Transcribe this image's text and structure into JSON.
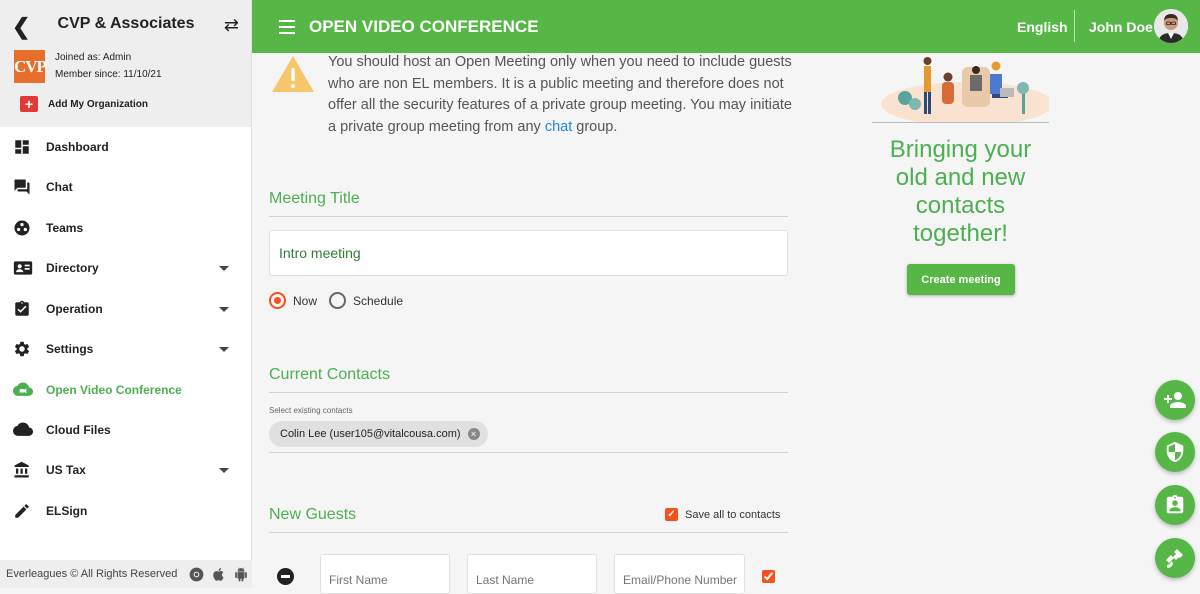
{
  "sidebar": {
    "org_name": "CVP & Associates",
    "logo_text": "CVP",
    "joined_as": "Joined as: Admin",
    "member_since": "Member since: 11/10/21",
    "add_org": "Add My Organization",
    "items": [
      {
        "label": "Dashboard",
        "icon": "dashboard-icon"
      },
      {
        "label": "Chat",
        "icon": "chat-icon"
      },
      {
        "label": "Teams",
        "icon": "teams-icon"
      },
      {
        "label": "Directory",
        "icon": "contact-card-icon",
        "expandable": true
      },
      {
        "label": "Operation",
        "icon": "clipboard-check-icon",
        "expandable": true
      },
      {
        "label": "Settings",
        "icon": "gear-icon",
        "expandable": true
      },
      {
        "label": "Open Video Conference",
        "icon": "cloud-video-icon",
        "active": true
      },
      {
        "label": "Cloud Files",
        "icon": "cloud-icon"
      },
      {
        "label": "US Tax",
        "icon": "bank-icon",
        "expandable": true
      },
      {
        "label": "ELSign",
        "icon": "pencil-icon"
      }
    ],
    "footer": "Everleagues © All Rights Reserved"
  },
  "header": {
    "title": "OPEN VIDEO CONFERENCE",
    "language": "English",
    "user_name": "John Doe"
  },
  "notice": {
    "text_before": "You should host an Open Meeting only when you need to include guests who are non EL members. It is a public meeting and therefore does not offer all the security features of a private group meeting. You may initiate a private group meeting from any ",
    "link": "chat",
    "text_after": " group."
  },
  "meeting": {
    "section_title": "Meeting Title",
    "title_value": "Intro meeting",
    "options": [
      "Now",
      "Schedule"
    ],
    "selected": "Now"
  },
  "contacts": {
    "section_title": "Current Contacts",
    "select_label": "Select existing contacts",
    "chips": [
      "Colin Lee (user105@vitalcousa.com)"
    ]
  },
  "guests": {
    "section_title": "New Guests",
    "save_all_label": "Save all to contacts",
    "save_all_checked": true,
    "first_name_placeholder": "First Name",
    "last_name_placeholder": "Last Name",
    "email_placeholder": "Email/Phone Number"
  },
  "promo": {
    "line1": "Bringing your",
    "line2": "old and new",
    "line3": "contacts",
    "line4": "together!",
    "button": "Create meeting"
  },
  "fabs": [
    "add-contact-icon",
    "shield-icon",
    "id-badge-icon",
    "satellite-icon"
  ],
  "colors": {
    "brand_green": "#56b747",
    "accent_orange": "#f4511e",
    "link_blue": "#1e88e5"
  }
}
